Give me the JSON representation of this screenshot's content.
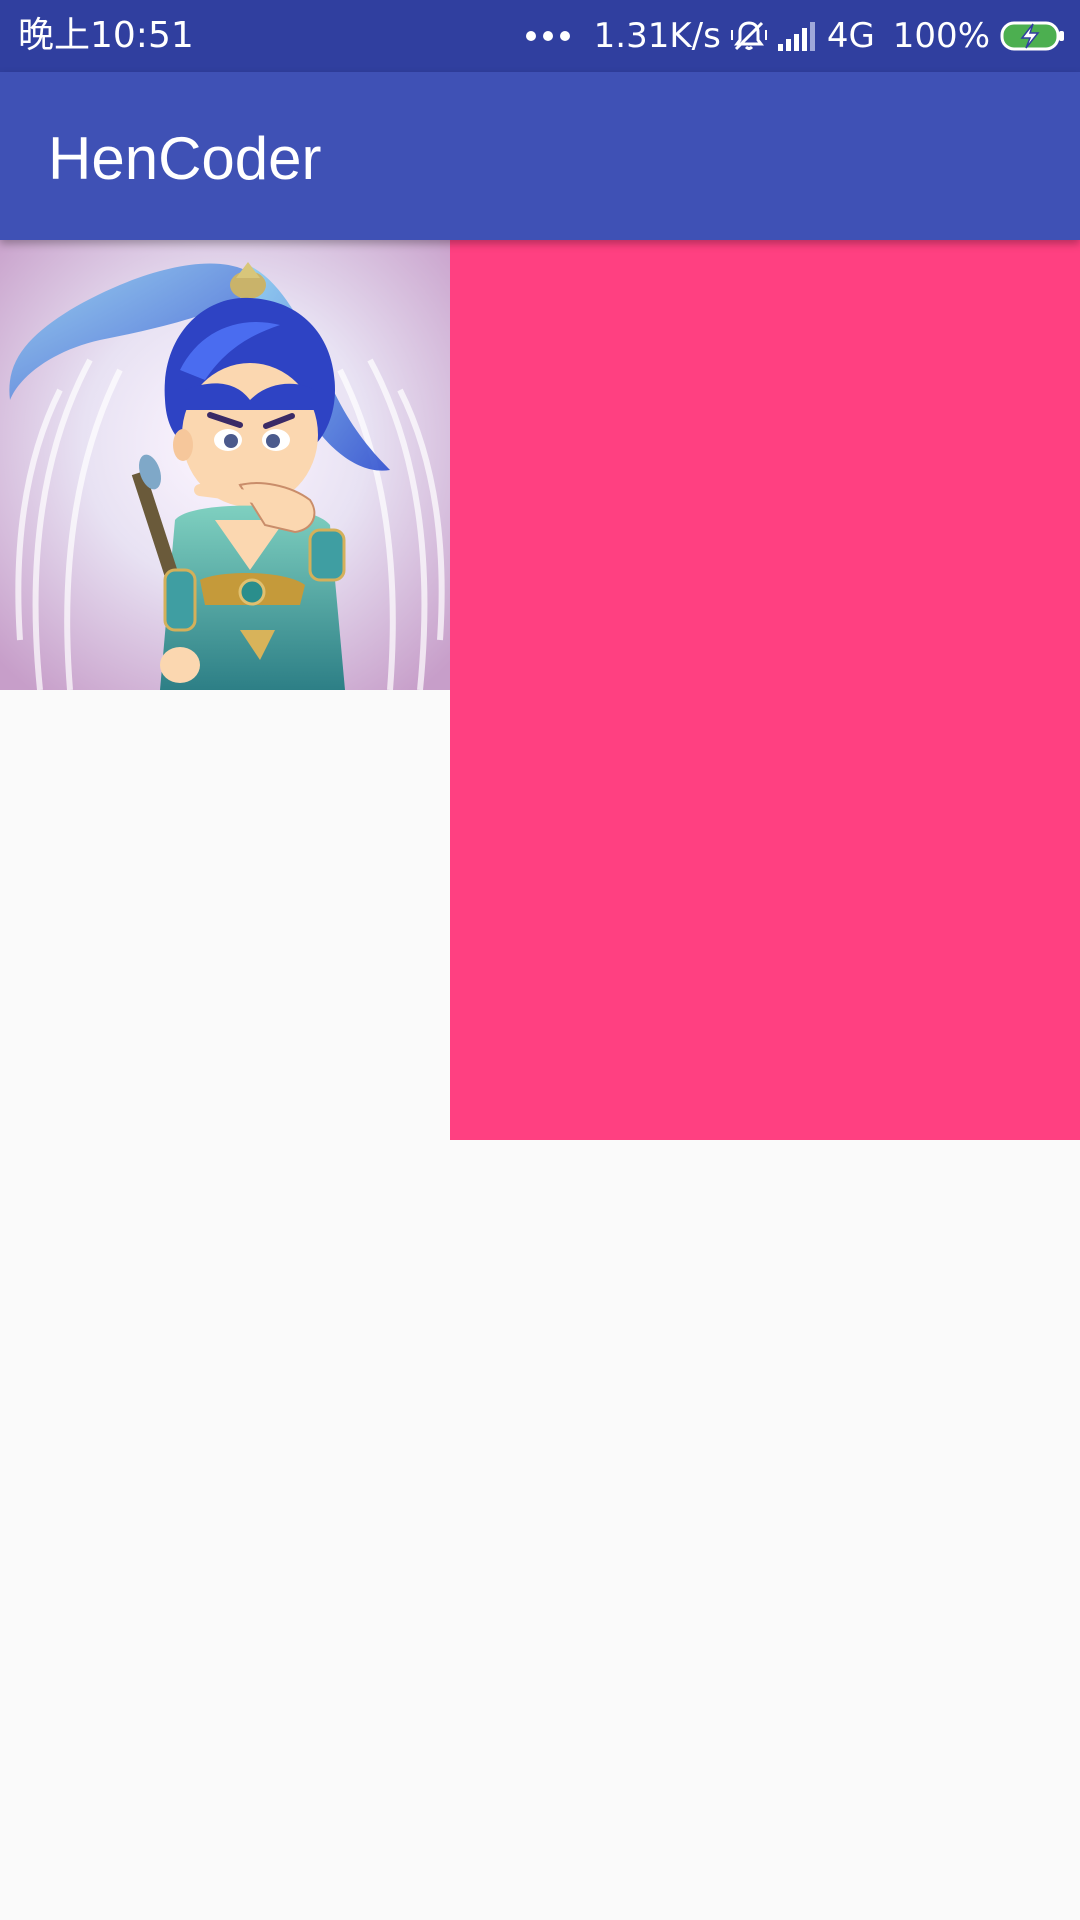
{
  "status_bar": {
    "time": "晚上10:51",
    "net_speed": "1.31K/s",
    "network_type": "4G",
    "battery_percent": "100%",
    "icons": [
      "more-dots-icon",
      "mute-vibrate-icon",
      "signal-icon",
      "battery-charging-icon"
    ],
    "colors": {
      "background": "#303f9f",
      "battery_fill": "#4caf50"
    }
  },
  "app_bar": {
    "title": "HenCoder",
    "background_color": "#3f51b5"
  },
  "content": {
    "image_subject": "cartoon-warrior-illustration",
    "block_color": "#ff4081",
    "background_color": "#fafafa"
  }
}
